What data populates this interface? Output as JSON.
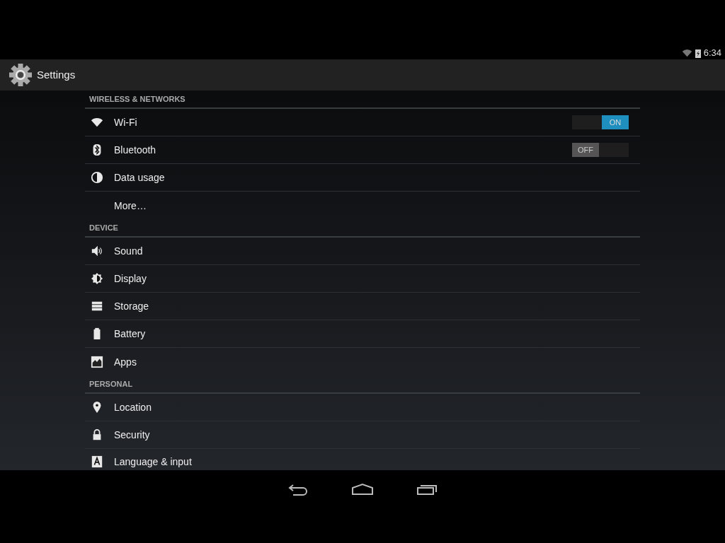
{
  "status_bar": {
    "time": "6:34"
  },
  "action_bar": {
    "title": "Settings"
  },
  "sections": [
    {
      "title": "WIRELESS & NETWORKS",
      "items": [
        {
          "label": "Wi-Fi",
          "kind": "toggle",
          "on": true,
          "switch_text": "ON"
        },
        {
          "label": "Bluetooth",
          "kind": "toggle",
          "on": false,
          "switch_text": "OFF"
        },
        {
          "label": "Data usage",
          "kind": "plain"
        },
        {
          "label": "More…",
          "kind": "plain"
        }
      ]
    },
    {
      "title": "DEVICE",
      "items": [
        {
          "label": "Sound",
          "kind": "plain"
        },
        {
          "label": "Display",
          "kind": "plain"
        },
        {
          "label": "Storage",
          "kind": "plain"
        },
        {
          "label": "Battery",
          "kind": "plain"
        },
        {
          "label": "Apps",
          "kind": "plain"
        }
      ]
    },
    {
      "title": "PERSONAL",
      "items": [
        {
          "label": "Location",
          "kind": "plain"
        },
        {
          "label": "Security",
          "kind": "plain"
        },
        {
          "label": "Language & input",
          "kind": "plain"
        }
      ]
    }
  ]
}
